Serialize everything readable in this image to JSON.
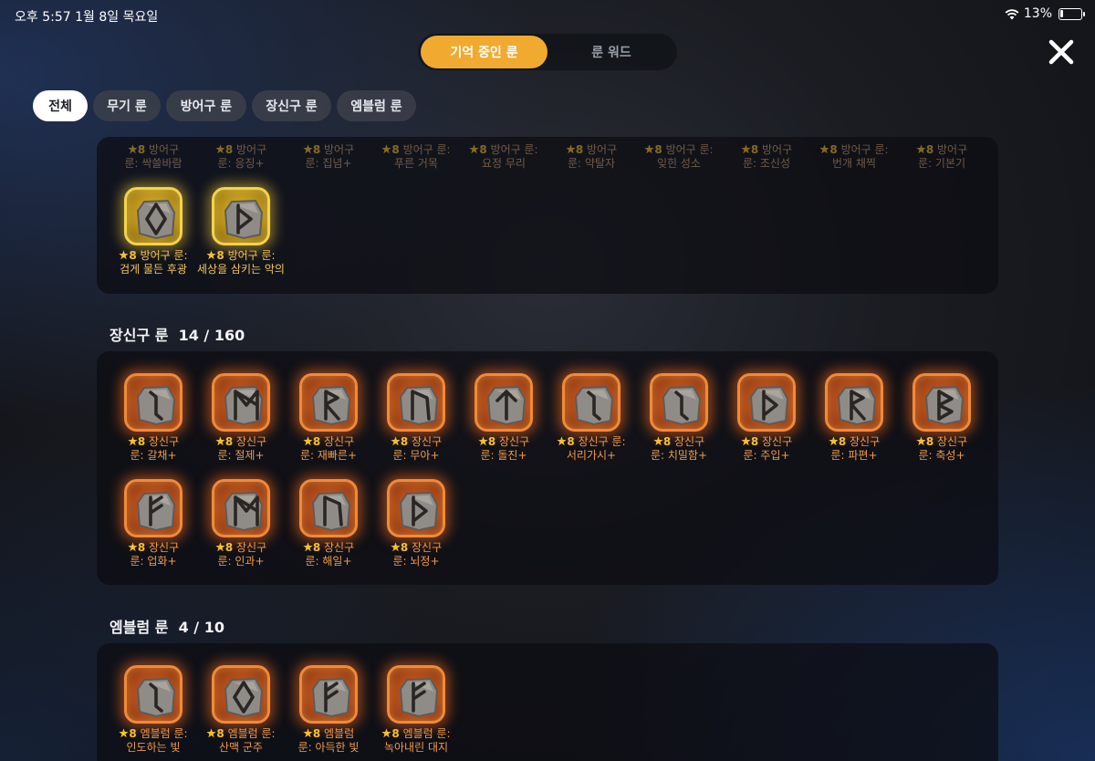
{
  "status_bar": {
    "time_date": "오후 5:57   1월 8일 목요일",
    "battery": "13%",
    "battery_level": 0.13
  },
  "top_tabs": [
    {
      "label": "기억 중인 룬",
      "active": true
    },
    {
      "label": "룬 워드",
      "active": false
    }
  ],
  "filters": [
    {
      "label": "전체",
      "active": true
    },
    {
      "label": "무기 룬",
      "active": false
    },
    {
      "label": "방어구 룬",
      "active": false
    },
    {
      "label": "장신구 룬",
      "active": false
    },
    {
      "label": "엠블럼 룬",
      "active": false
    }
  ],
  "armor_partial_row": [
    {
      "grade": "8",
      "line1": "방어구",
      "line2": "룬: 싹쓸바람"
    },
    {
      "grade": "8",
      "line1": "방어구",
      "line2": "룬: 응징+"
    },
    {
      "grade": "8",
      "line1": "방어구",
      "line2": "룬: 집념+"
    },
    {
      "grade": "8",
      "line1": "방어구 룬:",
      "line2": "푸른 거목"
    },
    {
      "grade": "8",
      "line1": "방어구 룬:",
      "line2": "요정 무리"
    },
    {
      "grade": "8",
      "line1": "방어구",
      "line2": "룬: 약탈자"
    },
    {
      "grade": "8",
      "line1": "방어구 룬:",
      "line2": "잊힌 성소"
    },
    {
      "grade": "8",
      "line1": "방어구",
      "line2": "룬: 조신성"
    },
    {
      "grade": "8",
      "line1": "방어구 룬:",
      "line2": "번개 채찍"
    },
    {
      "grade": "8",
      "line1": "방어구",
      "line2": "룬: 기본기"
    }
  ],
  "armor_gold_runes": [
    {
      "grade": "8",
      "line1": "방어구 룬:",
      "line2": "검게 물든 후광",
      "glyph": "diamond"
    },
    {
      "grade": "8",
      "line1": "방어구 룬:",
      "line2": "세상을 삼키는 악의",
      "glyph": "thorn"
    }
  ],
  "accessory_section": {
    "title": "장신구 룬",
    "count": "14 / 160"
  },
  "accessory_runes": [
    {
      "grade": "8",
      "line1": "장신구",
      "line2": "룬: 갈채+",
      "glyph": "eihwaz"
    },
    {
      "grade": "8",
      "line1": "장신구",
      "line2": "룬: 절제+",
      "glyph": "mannaz"
    },
    {
      "grade": "8",
      "line1": "장신구",
      "line2": "룬: 재빠른+",
      "glyph": "raido"
    },
    {
      "grade": "8",
      "line1": "장신구",
      "line2": "룬: 무아+",
      "glyph": "uruz"
    },
    {
      "grade": "8",
      "line1": "장신구",
      "line2": "룬: 돌진+",
      "glyph": "tiwaz"
    },
    {
      "grade": "8",
      "line1": "장신구 룬:",
      "line2": "서리가시+",
      "glyph": "eihwaz"
    },
    {
      "grade": "8",
      "line1": "장신구",
      "line2": "룬: 치밀함+",
      "glyph": "eihwaz"
    },
    {
      "grade": "8",
      "line1": "장신구",
      "line2": "룬: 주입+",
      "glyph": "thorn"
    },
    {
      "grade": "8",
      "line1": "장신구",
      "line2": "룬: 파편+",
      "glyph": "raido"
    },
    {
      "grade": "8",
      "line1": "장신구",
      "line2": "룬: 축성+",
      "glyph": "berkano"
    },
    {
      "grade": "8",
      "line1": "장신구",
      "line2": "룬: 업화+",
      "glyph": "fehu"
    },
    {
      "grade": "8",
      "line1": "장신구",
      "line2": "룬: 인과+",
      "glyph": "mannaz"
    },
    {
      "grade": "8",
      "line1": "장신구",
      "line2": "룬: 해일+",
      "glyph": "uruz"
    },
    {
      "grade": "8",
      "line1": "장신구",
      "line2": "룬: 뇌정+",
      "glyph": "thorn"
    }
  ],
  "emblem_section": {
    "title": "엠블럼 룬",
    "count": "4 / 10"
  },
  "emblem_runes": [
    {
      "grade": "8",
      "line1": "엠블럼 룬:",
      "line2": "인도하는 빛",
      "glyph": "eihwaz"
    },
    {
      "grade": "8",
      "line1": "엠블럼 룬:",
      "line2": "산맥 군주",
      "glyph": "diamond"
    },
    {
      "grade": "8",
      "line1": "엠블럼",
      "line2": "룬: 아득한 빛",
      "glyph": "fehu"
    },
    {
      "grade": "8",
      "line1": "엠블럼 룬:",
      "line2": "녹아내린 대지",
      "glyph": "fehu"
    }
  ],
  "colors": {
    "accent": "#f0aa30",
    "rune_orange": "#f08a3a",
    "rune_gold": "#f4d34a",
    "label_orange": "#f09a4a",
    "star": "#f5c030"
  },
  "icons": {
    "close": "close-icon",
    "wifi": "wifi-icon",
    "battery": "battery-icon",
    "star": "star-icon"
  }
}
